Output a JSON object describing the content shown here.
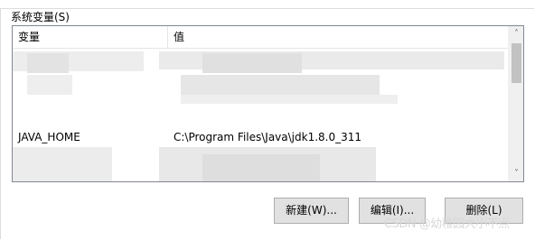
{
  "group": {
    "title": "系统变量(S)"
  },
  "list": {
    "columns": [
      "变量",
      "值"
    ],
    "visible_row": {
      "variable": "JAVA_HOME",
      "value": "C:\\Program Files\\Java\\jdk1.8.0_311"
    }
  },
  "scrollbar": {
    "up_glyph": "˄",
    "down_glyph": "˅"
  },
  "buttons": {
    "new_label": "新建(W)...",
    "edit_label": "编辑(I)...",
    "delete_label": "删除(L)"
  },
  "watermark": {
    "text": "CSDN @幼稚园大小不点"
  }
}
